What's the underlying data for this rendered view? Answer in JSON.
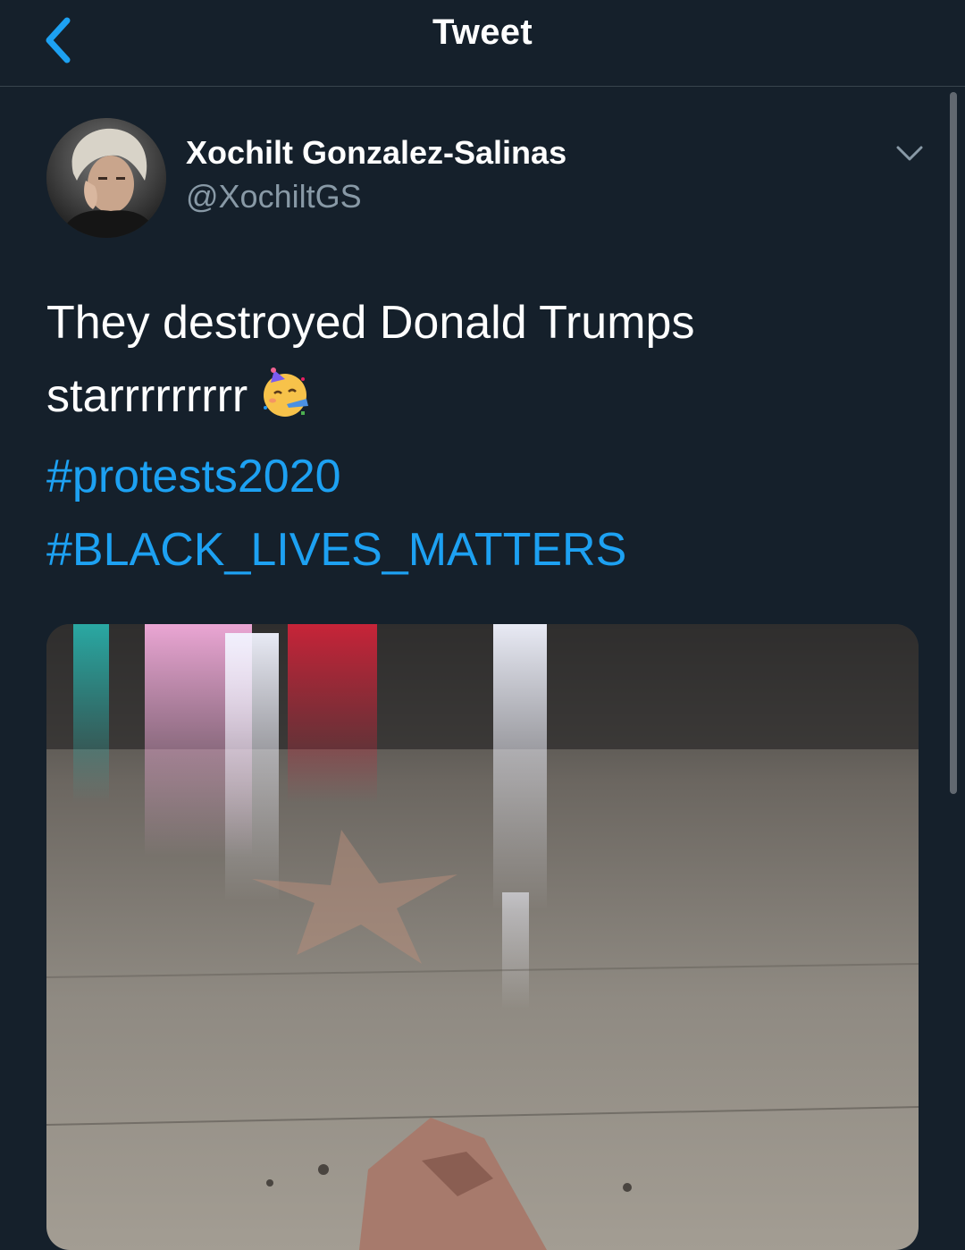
{
  "nav": {
    "title": "Tweet",
    "back_icon": "chevron-left-icon",
    "accent_color": "#1da1f2"
  },
  "tweet": {
    "author": {
      "display_name": "Xochilt Gonzalez-Salinas",
      "handle": "@XochiltGS"
    },
    "more_icon": "chevron-down-icon",
    "text_line1": "They destroyed Donald Trumps",
    "text_line2": "starrrrrrrrr",
    "emoji": "partying-face-emoji",
    "hashtags": [
      "#protests2020",
      "#BLACK_LIVES_MATTERS"
    ],
    "media": {
      "type": "photo",
      "content": "Damaged Hollywood Walk of Fame star on sidewalk at night"
    }
  },
  "colors": {
    "background": "#15202b",
    "text": "#ffffff",
    "secondary_text": "#8899a6",
    "link": "#1da1f2",
    "divider": "#38444d"
  }
}
